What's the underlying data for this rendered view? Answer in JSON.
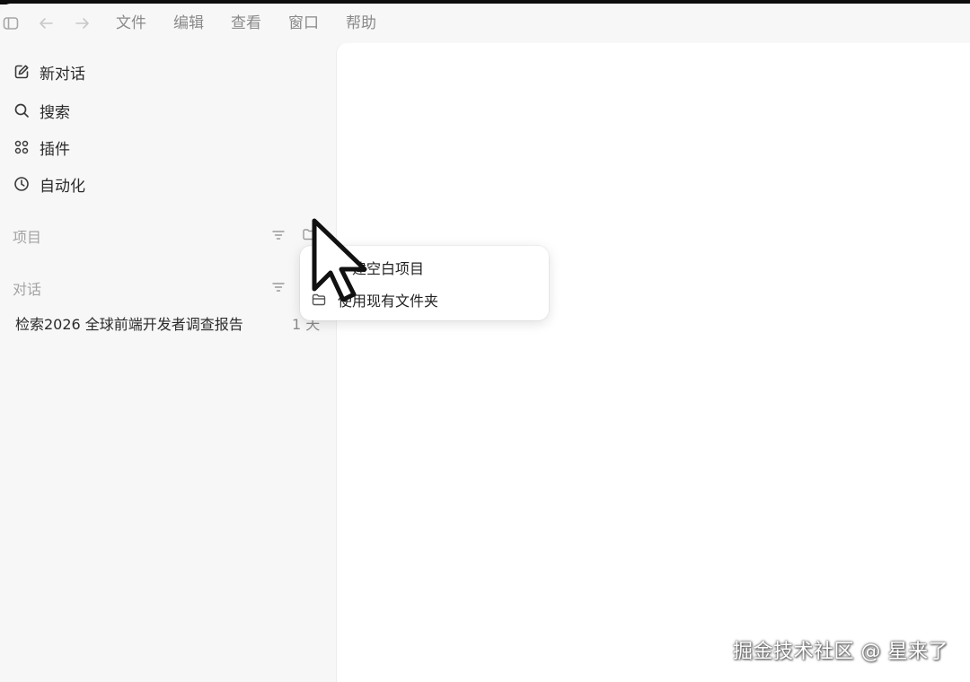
{
  "menu": {
    "items": [
      "文件",
      "编辑",
      "查看",
      "窗口",
      "帮助"
    ]
  },
  "sidebar": {
    "nav": [
      {
        "label": "新对话",
        "icon": "edit-icon"
      },
      {
        "label": "搜索",
        "icon": "search-icon"
      },
      {
        "label": "插件",
        "icon": "plugins-grid-icon"
      },
      {
        "label": "自动化",
        "icon": "clock-icon"
      }
    ],
    "projects_label": "项目",
    "conversations_label": "对话",
    "conversations": [
      {
        "title": "检索2026 全球前端开发者调查报告",
        "time": "1 天"
      }
    ]
  },
  "dropdown": {
    "items": [
      {
        "label": "建空白项目",
        "icon": "new-project-icon"
      },
      {
        "label": "使用现有文件夹",
        "icon": "folder-icon"
      }
    ]
  },
  "watermark": "掘金技术社区 @ 星来了"
}
